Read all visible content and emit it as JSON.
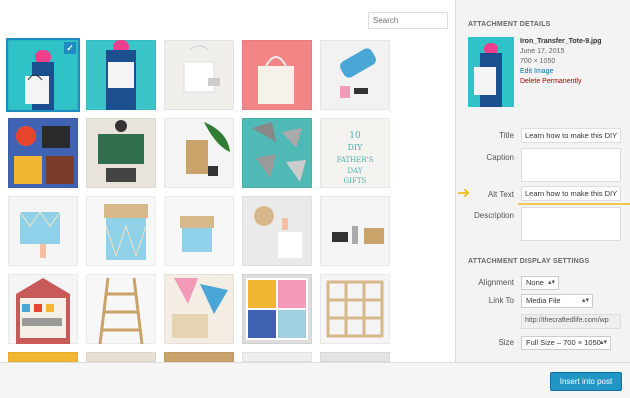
{
  "search": {
    "placeholder": "Search"
  },
  "attachment_details": {
    "heading": "ATTACHMENT DETAILS",
    "filename": "Iron_Transfer_Tote-9.jpg",
    "date": "June 17, 2015",
    "dimensions": "700 × 1050",
    "edit_link": "Edit Image",
    "delete_link": "Delete Permanently"
  },
  "fields": {
    "title_label": "Title",
    "title_value": "Learn how to make this DIY",
    "caption_label": "Caption",
    "alt_label": "Alt Text",
    "alt_value": "Learn how to make this DIY",
    "description_label": "Description"
  },
  "display_settings": {
    "heading": "ATTACHMENT DISPLAY SETTINGS",
    "alignment_label": "Alignment",
    "alignment_value": "None",
    "link_to_label": "Link To",
    "link_to_value": "Media File",
    "link_url": "http://thecraftedlife.com/wp",
    "size_label": "Size",
    "size_value": "Full Size – 700 × 1050"
  },
  "toolbar": {
    "insert_label": "Insert into post"
  },
  "colors": {
    "accent": "#1e8cbe",
    "button": "#2196c4",
    "highlight": "#f0c94c"
  }
}
